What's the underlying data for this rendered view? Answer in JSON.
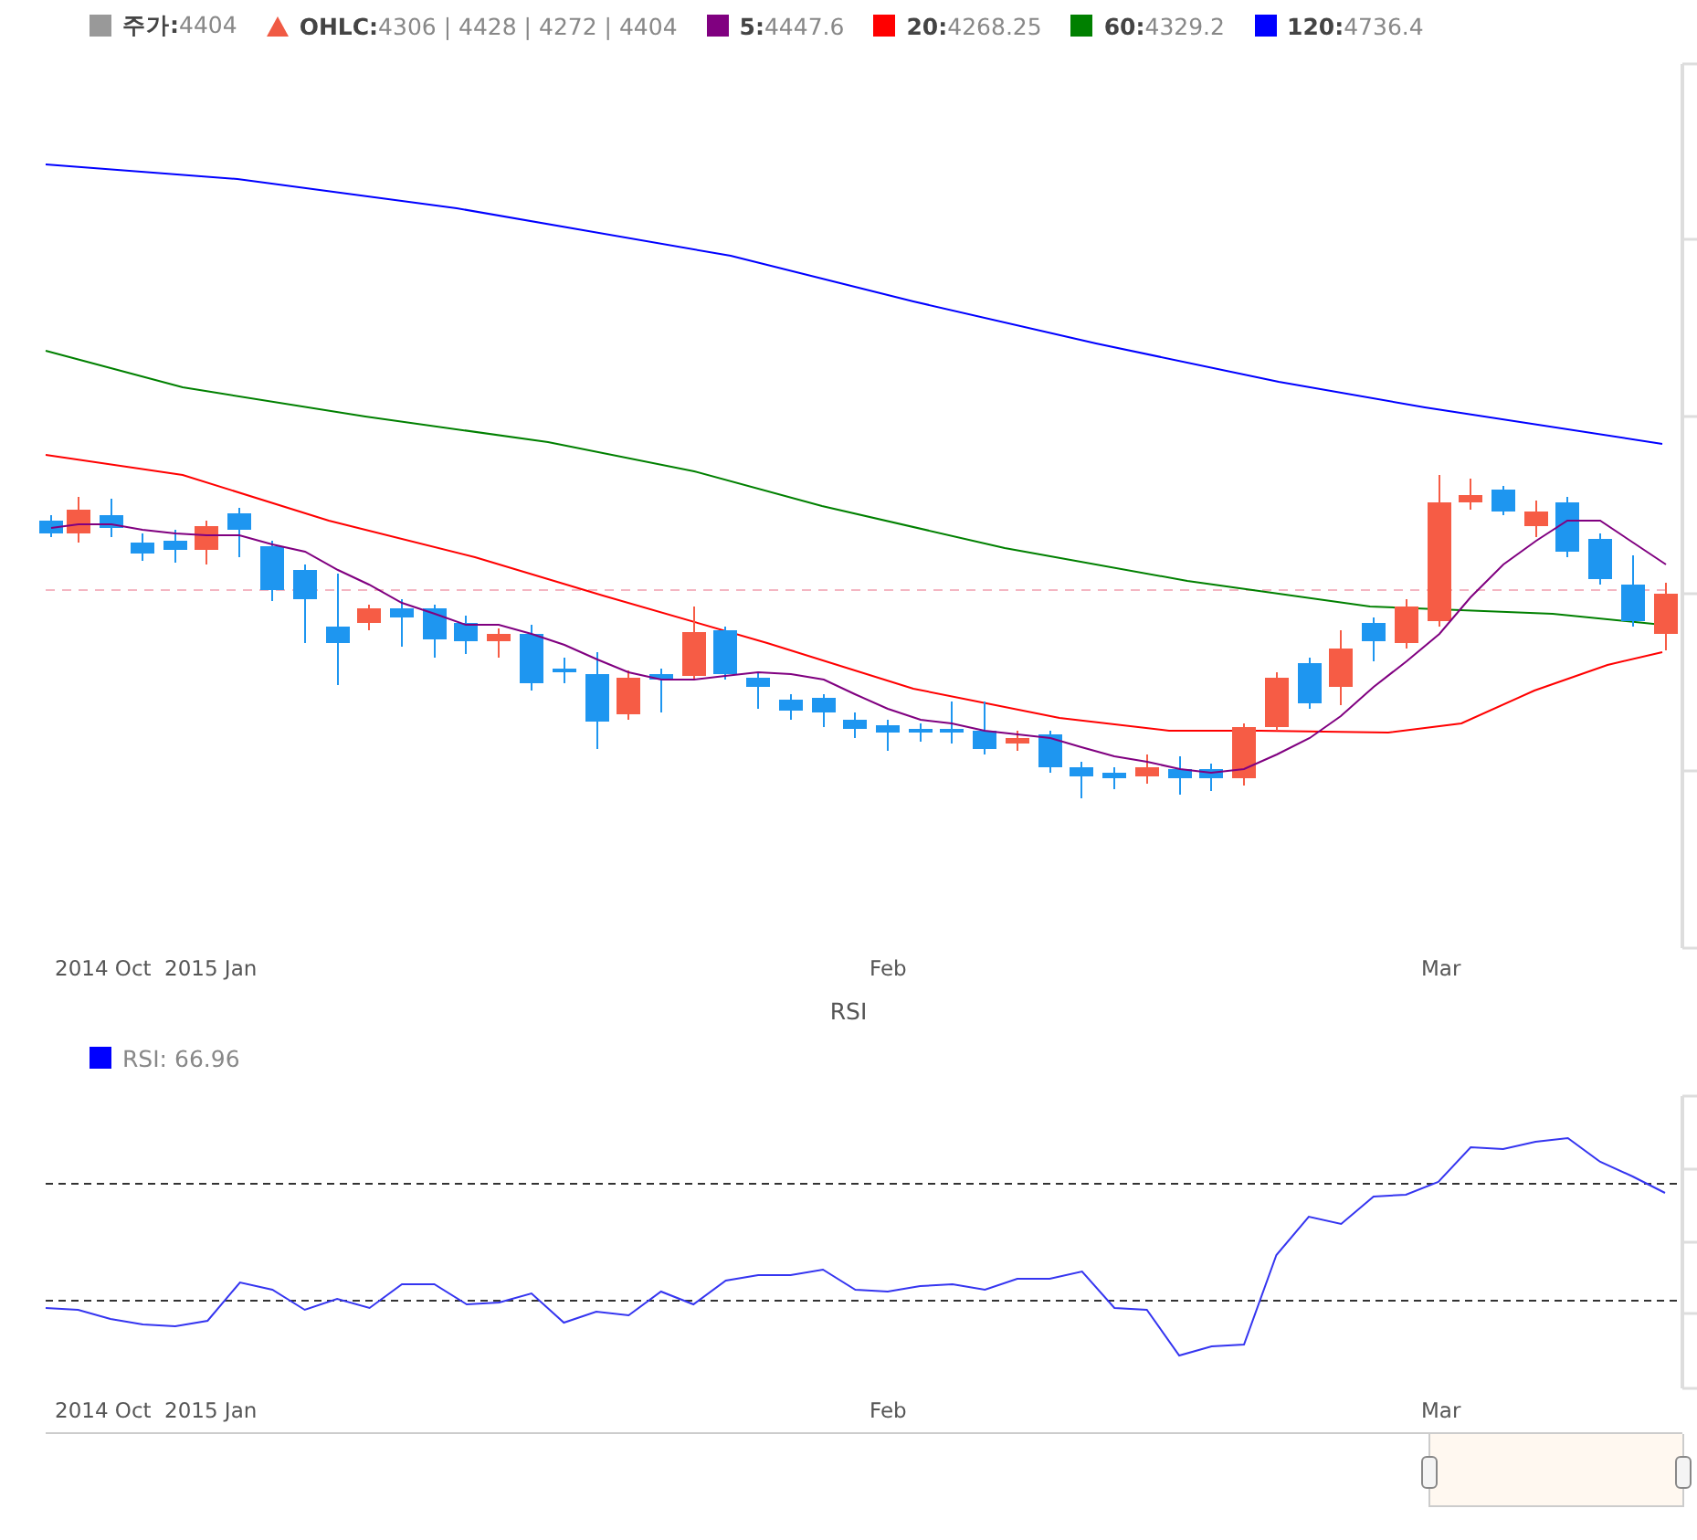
{
  "price_panel": {
    "legend": [
      {
        "kind": "square",
        "color": "#999999",
        "text": "**주가:**4404"
      },
      {
        "kind": "triangle",
        "color": "#f05a44",
        "text": "**OHLC:**4306 | 4428 | 4272 | 4404"
      },
      {
        "kind": "square",
        "color": "#800080",
        "text": "**5:**4447.6"
      },
      {
        "kind": "square",
        "color": "#ff0000",
        "text": "**20:**4268.25"
      },
      {
        "kind": "square",
        "color": "#008000",
        "text": "**60:**4329.2"
      },
      {
        "kind": "square",
        "color": "#0000ff",
        "text": "**120:**4736.4"
      }
    ],
    "x_labels": [
      "2014 Oct",
      "2015 Jan",
      "Feb",
      "Mar"
    ]
  },
  "rsi_panel": {
    "title": "RSI",
    "legend": [
      {
        "kind": "square",
        "color": "#0000ff",
        "text": "RSI: 66.96"
      }
    ],
    "x_labels": [
      "2014 Oct",
      "2015 Jan",
      "Feb",
      "Mar"
    ]
  }
}
